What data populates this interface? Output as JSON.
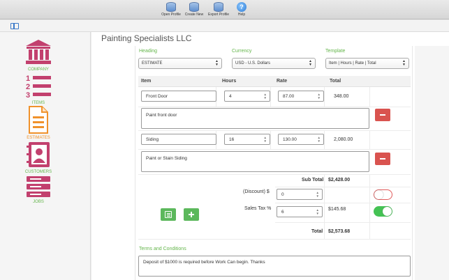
{
  "toolbar": {
    "open_profile": "Open Profile",
    "create_new": "Create New",
    "export_profile": "Export Profile",
    "help": "Help"
  },
  "sidebar": {
    "items": [
      {
        "label": "COMPANY"
      },
      {
        "label": "ITEMS"
      },
      {
        "label": "ESTIMATES"
      },
      {
        "label": "CUSTOMERS"
      },
      {
        "label": "JOBS"
      }
    ]
  },
  "company_name": "Painting Specialists LLC",
  "form": {
    "heading_label": "Heading",
    "heading_value": "ESTIMATE",
    "currency_label": "Currency",
    "currency_value": "USD - U.S. Dollars",
    "template_label": "Template",
    "template_value": "Item | Hours | Rate | Total"
  },
  "table": {
    "headers": [
      "Item",
      "Hours",
      "Rate",
      "Total"
    ],
    "rows": [
      {
        "item": "Front Door",
        "hours": "4",
        "rate": "87.00",
        "total": "348.00",
        "description": "Paint front door"
      },
      {
        "item": "Siding",
        "hours": "16",
        "rate": "130.00",
        "total": "2,080.00",
        "description": "Paint or Stain Siding"
      }
    ]
  },
  "summary": {
    "subtotal_label": "Sub Total",
    "subtotal_value": "$2,428.00",
    "discount_label": "(Discount) $",
    "discount_value": "0",
    "tax_label": "Sales Tax %",
    "tax_value": "6",
    "tax_amount": "$145.68",
    "total_label": "Total",
    "total_value": "$2,573.68"
  },
  "terms": {
    "label": "Terms and Conditions",
    "value": "Deposit of $1000 is required before Work Can begin. Thanks"
  },
  "colors": {
    "accent_green": "#63b54a",
    "brand_magenta": "#c2406e",
    "estimates_orange": "#f0922b",
    "delete_red": "#d9534f"
  }
}
